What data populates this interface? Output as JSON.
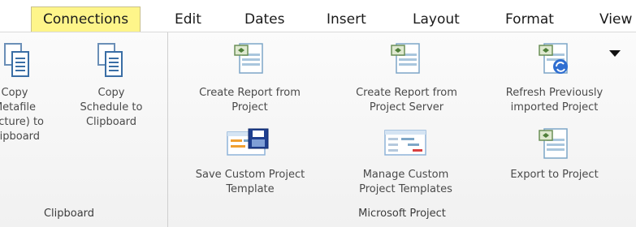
{
  "tabs": [
    {
      "label": "Connections",
      "active": true
    },
    {
      "label": "Edit"
    },
    {
      "label": "Dates"
    },
    {
      "label": "Insert"
    },
    {
      "label": "Layout"
    },
    {
      "label": "Format"
    },
    {
      "label": "View"
    }
  ],
  "clipboard_group": {
    "label": "Clipboard",
    "copy_metafile": "Copy\nMetafile\n(Picture) to\nClipboard",
    "copy_schedule": "Copy\nSchedule to\nClipboard"
  },
  "project_group": {
    "label": "Microsoft Project",
    "create_report_project": "Create Report from\nProject",
    "create_report_server": "Create Report from\nProject Server",
    "refresh_imported": "Refresh Previously\nimported Project",
    "save_template": "Save Custom Project\nTemplate",
    "manage_templates": "Manage Custom\nProject Templates",
    "export_project": "Export to Project"
  },
  "icons": {
    "copy": "copy-pages-icon",
    "project_file": "project-file-icon",
    "refresh": "refresh-project-icon",
    "save_template": "save-template-icon",
    "manage_templates": "manage-templates-icon",
    "dropdown": "dropdown-arrow-icon"
  },
  "colors": {
    "active_tab": "#fef58a",
    "ribbon_bg": "#f4f4f4",
    "label_text": "#4a4a4a"
  }
}
